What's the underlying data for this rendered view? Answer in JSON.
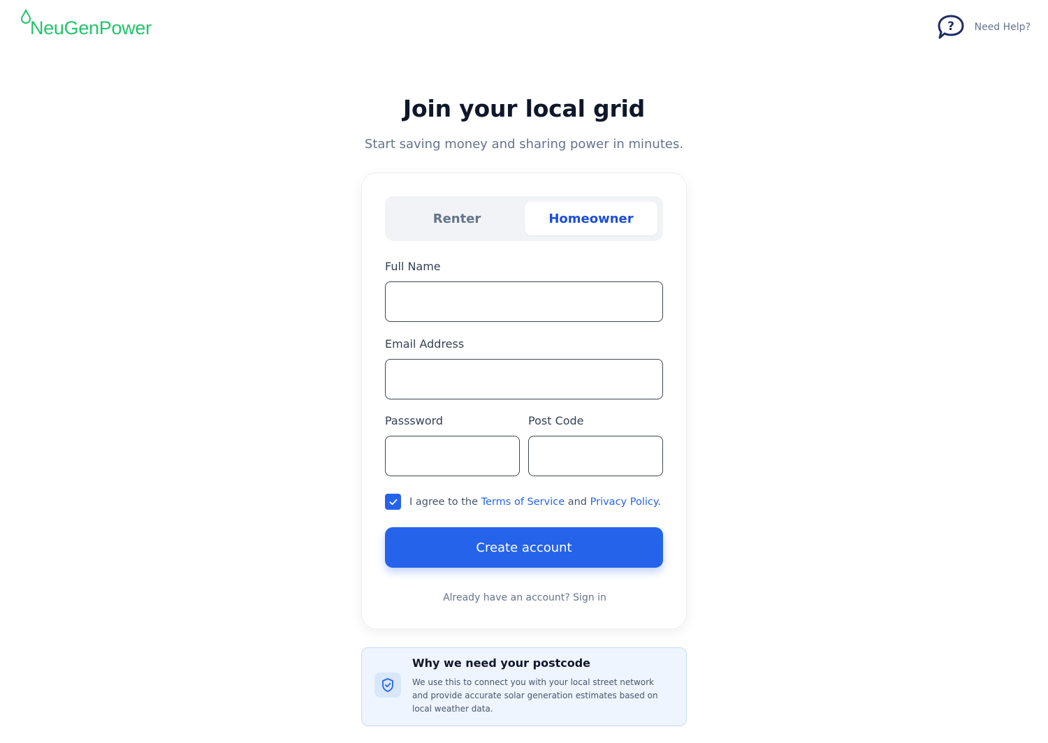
{
  "brand": {
    "name": "NeuGenPower",
    "color": "#22c46b"
  },
  "header": {
    "help_label": "Need Help?"
  },
  "hero": {
    "title": "Join your local grid",
    "subtitle": "Start saving money and sharing power in minutes."
  },
  "toggle": {
    "options": [
      "Renter",
      "Homeowner"
    ],
    "selected": "Homeowner"
  },
  "form": {
    "full_name_label": "Full Name",
    "full_name_value": "",
    "email_label": "Email Address",
    "email_value": "",
    "password_label": "Passsword",
    "password_value": "",
    "postcode_label": "Post Code",
    "postcode_value": "",
    "agree_prefix": "I agree to the ",
    "terms_link": "Terms of Service",
    "agree_and": " and ",
    "privacy_link": "Privacy Policy",
    "agree_suffix": ".",
    "agree_checked": true,
    "submit_label": "Create account",
    "signin_text": "Already have an account? Sign in"
  },
  "info": {
    "title": "Why we need your postcode",
    "body": "We use this to connect you with your local street network and provide accurate solar generation estimates based on local weather data."
  },
  "colors": {
    "primary": "#2563eb",
    "text_dark": "#0f172a",
    "muted": "#64748b",
    "info_bg": "#eef5ff"
  },
  "icons": {
    "help": "question-bubble-icon",
    "check": "check-icon",
    "shield": "shield-check-icon",
    "leaf": "leaf-icon"
  }
}
